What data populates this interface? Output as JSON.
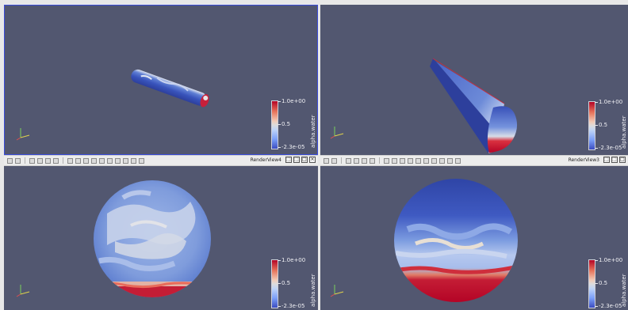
{
  "views": {
    "tl": {
      "legend": {
        "max": "1.0e+00",
        "mid": "0.5",
        "min": "-2.3e-05",
        "title": "alpha.water"
      }
    },
    "tr": {
      "legend": {
        "max": "1.0e+00",
        "mid": "0.5",
        "min": "-2.3e-05",
        "title": "alpha.water"
      }
    },
    "bl": {
      "legend": {
        "max": "1.0e+00",
        "mid": "0.5",
        "min": "-2.3e-05",
        "title": "alpha.water"
      }
    },
    "br": {
      "legend": {
        "max": "1.0e+00",
        "mid": "0.5",
        "min": "-2.3e-05",
        "title": "alpha.water"
      }
    }
  },
  "toolbars": {
    "left": {
      "view_name": "RenderView4"
    },
    "right": {
      "view_name": "RenderView3"
    }
  },
  "colors": {
    "background": "#525770",
    "water": "#b40426",
    "air": "#3b4cc0"
  }
}
